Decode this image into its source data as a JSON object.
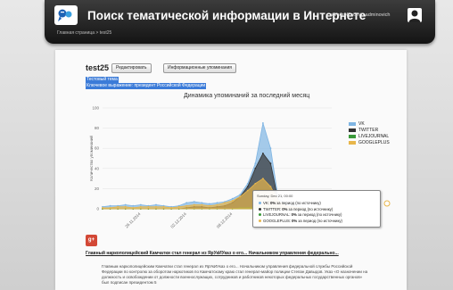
{
  "header": {
    "site_title": "Поиск тематической информации в Интернете",
    "breadcrumb_home": "Главная страница",
    "breadcrumb_sep": " > ",
    "breadcrumb_current": "test25",
    "user_name": "admeroff admin adminovich"
  },
  "page": {
    "title": "test25",
    "edit_label": "Редактировать",
    "mentions_label": "Информационные упоминания",
    "type_line": "Тестовый тема",
    "query_line": "Ключевое выражение: президент Российской Федерации"
  },
  "chart_data": {
    "type": "area",
    "title": "Динамика упоминаний за последний месяц",
    "ylabel": "Количество упоминаний",
    "ylim": [
      0,
      100
    ],
    "yticks": [
      0,
      20,
      40,
      60,
      80,
      100
    ],
    "x_tick_labels": [
      "26.11.2014",
      "02.12.2014",
      "08.12.2014"
    ],
    "x": [
      "21.11",
      "22.11",
      "23.11",
      "24.11",
      "25.11",
      "26.11",
      "27.11",
      "28.11",
      "29.11",
      "30.11",
      "01.12",
      "02.12",
      "03.12",
      "04.12",
      "05.12",
      "06.12",
      "07.12",
      "08.12",
      "09.12",
      "10.12",
      "11.12",
      "12.12",
      "13.12",
      "14.12",
      "15.12",
      "16.12",
      "17.12",
      "18.12",
      "19.12",
      "20.12",
      "21.12"
    ],
    "series": [
      {
        "name": "VK",
        "color": "#7fb5e3",
        "values": [
          2,
          3,
          3,
          4,
          3,
          4,
          3,
          4,
          3,
          2,
          3,
          6,
          7,
          6,
          5,
          6,
          7,
          10,
          14,
          25,
          45,
          85,
          60,
          10,
          5,
          3,
          2,
          0,
          0,
          0,
          0
        ]
      },
      {
        "name": "TWITTER",
        "color": "#333333",
        "values": [
          0,
          0,
          0,
          0,
          0,
          0,
          0,
          0,
          0,
          0,
          0,
          1,
          2,
          2,
          1,
          2,
          3,
          6,
          12,
          22,
          40,
          55,
          45,
          8,
          3,
          2,
          1,
          0,
          0,
          0,
          0
        ]
      },
      {
        "name": "LIVEJOURNAL",
        "color": "#3a9a3a",
        "values": [
          0,
          0,
          0,
          0,
          0,
          0,
          0,
          0,
          0,
          0,
          0,
          0,
          0,
          0,
          0,
          0,
          0,
          0,
          1,
          1,
          2,
          3,
          2,
          1,
          0,
          0,
          0,
          0,
          0,
          0,
          0
        ]
      },
      {
        "name": "GOOGLEPLUS",
        "color": "#e8b64a",
        "values": [
          1,
          1,
          2,
          2,
          1,
          2,
          2,
          2,
          2,
          1,
          2,
          3,
          4,
          4,
          3,
          4,
          6,
          8,
          12,
          18,
          25,
          30,
          22,
          8,
          3,
          2,
          1,
          0,
          0,
          0,
          0
        ]
      }
    ]
  },
  "tooltip": {
    "date": "Sunday, Dec 21, 00:00",
    "rows": [
      {
        "name": "VK",
        "pct": "0%",
        "text": "за период (по источнику)",
        "color": "#7fb5e3"
      },
      {
        "name": "TWITTER",
        "pct": "0%",
        "text": "за период (по источнику)",
        "color": "#333333"
      },
      {
        "name": "LIVEJOURNAL",
        "pct": "0%",
        "text": "за период (по источнику)",
        "color": "#3a9a3a"
      },
      {
        "name": "GOOGLEPLUS",
        "pct": "0%",
        "text": "за период (по источнику)",
        "color": "#e8b64a"
      }
    ]
  },
  "result": {
    "source_icon": "g+",
    "title": "Главный наркополицейский Камчатки стал генерал из ЯрУкИУказ о его... Начальником управления федерально...",
    "body": "Главным наркополицейским Камчатки стал генерал из ЯрУкИУказ о его... Начальником управления федеральной службы Российской Федерации по контролю за оборотом наркотиков по Камчатскому краю стал генерал-майор полиции Степан Давыдов. Указ «О назначении на должность и освобождении от должности военнослужащих, сотрудников и работников некоторых федеральных государственных органов» был подписан президентом 5"
  }
}
